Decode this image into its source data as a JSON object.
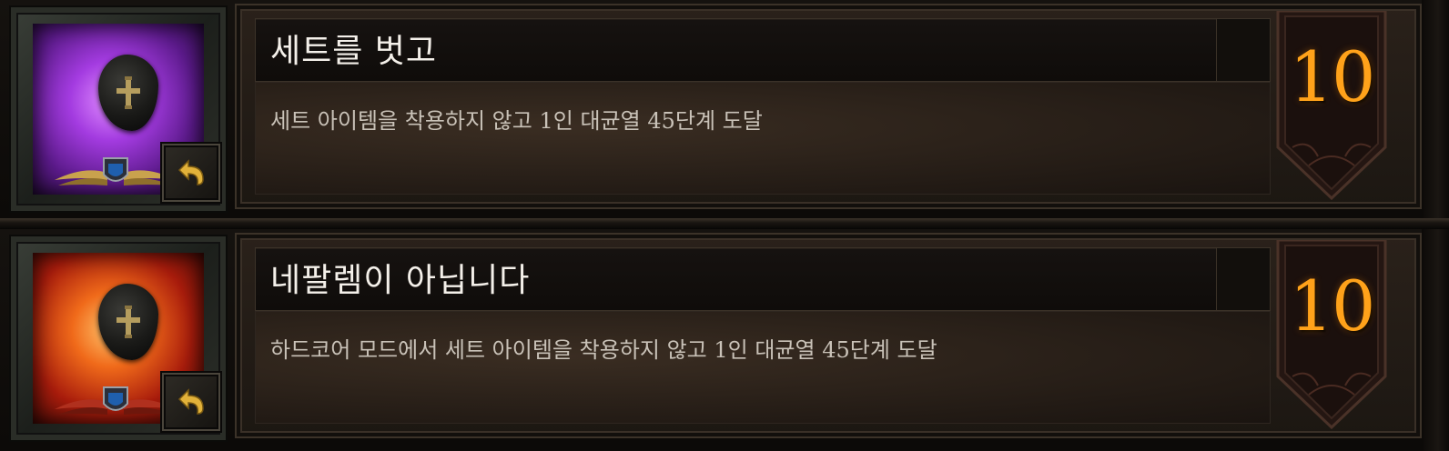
{
  "achievements": [
    {
      "title": "세트를 벗고",
      "description": "세트 아이템을 착용하지 않고 1인 대균열 45단계 도달",
      "points": "10",
      "icon": "stone-cross-icon",
      "icon_theme": "purple",
      "accent_color": "#ffa21a"
    },
    {
      "title": "네팔렘이 아닙니다",
      "description": "하드코어 모드에서 세트 아이템을 착용하지 않고 1인 대균열 45단계 도달",
      "points": "10",
      "icon": "stone-cross-icon",
      "icon_theme": "red",
      "accent_color": "#ffa21a"
    }
  ]
}
